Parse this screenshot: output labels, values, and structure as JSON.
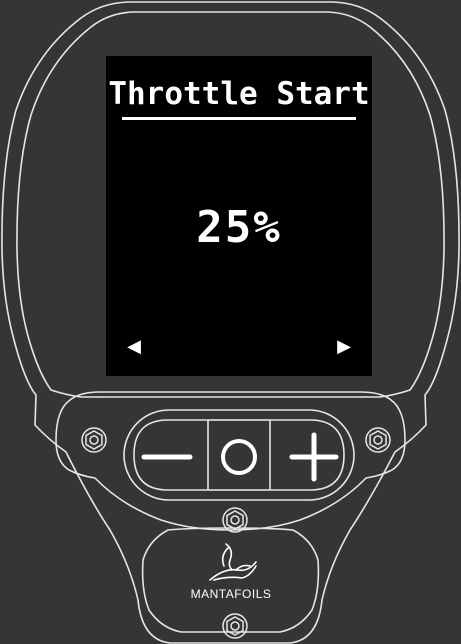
{
  "screen": {
    "title": "Throttle Start",
    "value": "25%",
    "nav_left_icon": "triangle-left-icon",
    "nav_right_icon": "triangle-right-icon",
    "nav_left_glyph": "◀",
    "nav_right_glyph": "▶"
  },
  "controls": {
    "minus_icon": "minus-icon",
    "ok_icon": "circle-icon",
    "plus_icon": "plus-icon"
  },
  "brand": {
    "name": "MANTAFOILS",
    "logo_icon": "manta-logo-icon"
  },
  "colors": {
    "background": "#353535",
    "outline": "#e6e6e6",
    "screen": "#000000",
    "text": "#ffffff"
  }
}
